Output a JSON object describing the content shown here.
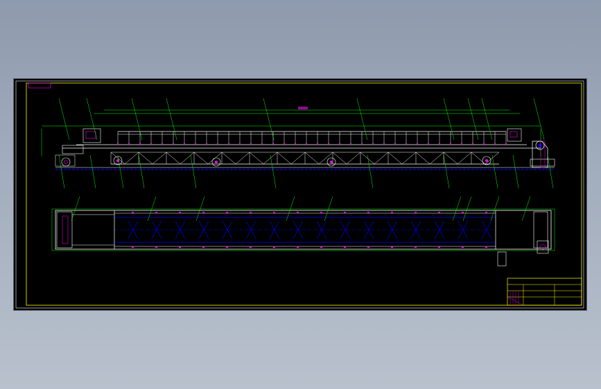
{
  "drawing": {
    "frame_tag": "",
    "dimension_label": "",
    "note_text": "",
    "title_block_rows": [
      "",
      "",
      "",
      ""
    ]
  },
  "colors": {
    "background": "#000000",
    "frame": "#ffff00",
    "outline": "#00ff00",
    "body": "#ffffff",
    "accent": "#ff00ff",
    "hidden": "#0000ff",
    "leader": "#00ff00"
  },
  "views": [
    "elevation-view",
    "plan-view",
    "title-block"
  ]
}
